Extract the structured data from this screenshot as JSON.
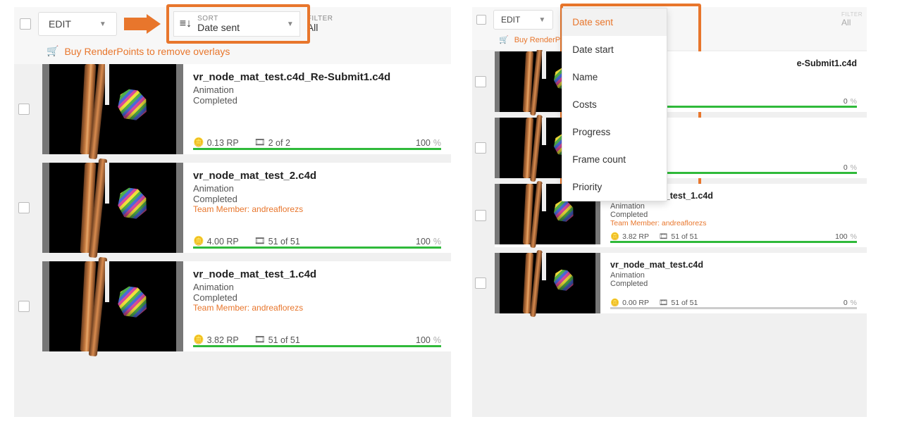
{
  "colors": {
    "accent": "#e8762c",
    "success": "#2fba3a"
  },
  "common": {
    "edit_label": "EDIT",
    "sort_label": "SORT",
    "filter_label": "FILTER",
    "filter_value": "All",
    "buy_msg": "Buy RenderPoints to remove overlays"
  },
  "left": {
    "sort_value": "Date sent",
    "jobs": [
      {
        "title": "vr_node_mat_test.c4d_Re-Submit1.c4d",
        "type": "Animation",
        "status": "Completed",
        "team": "",
        "rp": "0.13 RP",
        "frames": "2 of 2",
        "progress": "100"
      },
      {
        "title": "vr_node_mat_test_2.c4d",
        "type": "Animation",
        "status": "Completed",
        "team": "Team Member: andreaflorezs",
        "rp": "4.00 RP",
        "frames": "51 of 51",
        "progress": "100"
      },
      {
        "title": "vr_node_mat_test_1.c4d",
        "type": "Animation",
        "status": "Completed",
        "team": "Team Member: andreaflorezs",
        "rp": "3.82 RP",
        "frames": "51 of 51",
        "progress": "100"
      }
    ]
  },
  "right": {
    "sort_options": [
      "Date sent",
      "Date start",
      "Name",
      "Costs",
      "Progress",
      "Frame count",
      "Priority"
    ],
    "jobs": [
      {
        "title": "e-Submit1.c4d",
        "type": "",
        "status": "",
        "team": "",
        "rp": "",
        "frames": "",
        "progress": "0"
      },
      {
        "title": "",
        "type": "",
        "status": "",
        "team": "",
        "rp": "",
        "frames": "",
        "progress": "0"
      },
      {
        "title": "vr_node_mat_test_1.c4d",
        "type": "Animation",
        "status": "Completed",
        "team": "Team Member: andreaflorezs",
        "rp": "3.82 RP",
        "frames": "51 of 51",
        "progress": "100"
      },
      {
        "title": "vr_node_mat_test.c4d",
        "type": "Animation",
        "status": "Completed",
        "team": "",
        "rp": "0.00 RP",
        "frames": "51 of 51",
        "progress": "0"
      }
    ]
  }
}
